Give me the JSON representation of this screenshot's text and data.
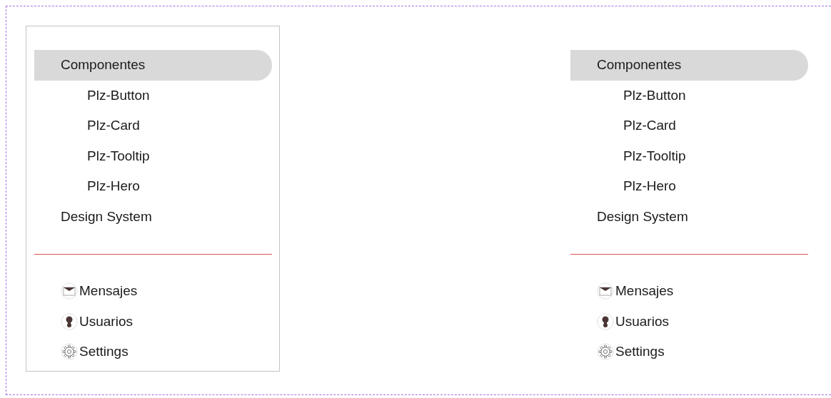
{
  "panels": [
    {
      "bordered": true,
      "nav": [
        {
          "label": "Componentes",
          "selected": true,
          "children": [
            {
              "label": "Plz-Button",
              "selected": false
            },
            {
              "label": "Plz-Card",
              "selected": false
            },
            {
              "label": "Plz-Tooltip",
              "selected": false
            },
            {
              "label": "Plz-Hero",
              "selected": false
            }
          ]
        },
        {
          "label": "Design System",
          "selected": false
        }
      ],
      "links": [
        {
          "kind": "mail",
          "label": "Mensajes"
        },
        {
          "kind": "user",
          "label": "Usuarios"
        },
        {
          "kind": "gear",
          "label": "Settings"
        }
      ]
    },
    {
      "bordered": false,
      "nav": [
        {
          "label": "Componentes",
          "selected": true,
          "children": [
            {
              "label": "Plz-Button",
              "selected": false
            },
            {
              "label": "Plz-Card",
              "selected": false
            },
            {
              "label": "Plz-Tooltip",
              "selected": false
            },
            {
              "label": "Plz-Hero",
              "selected": false
            }
          ]
        },
        {
          "label": "Design System",
          "selected": false
        }
      ],
      "links": [
        {
          "kind": "mail",
          "label": "Mensajes"
        },
        {
          "kind": "user",
          "label": "Usuarios"
        },
        {
          "kind": "gear",
          "label": "Settings"
        }
      ]
    }
  ]
}
